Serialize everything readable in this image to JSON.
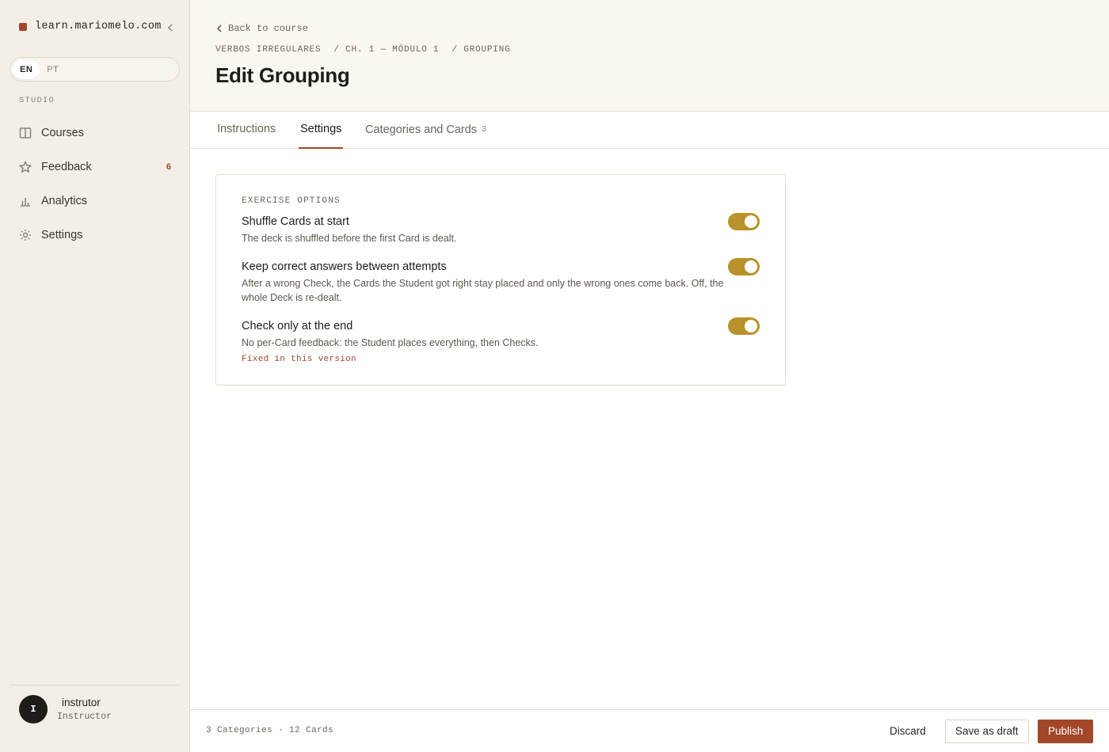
{
  "sidebar": {
    "brand": "learn.mariomelo.com",
    "lang": [
      "EN",
      "PT"
    ],
    "section_label": "STUDIO",
    "items": [
      {
        "label": "Courses",
        "icon": "book-icon"
      },
      {
        "label": "Feedback",
        "icon": "star-icon",
        "badge": "6"
      },
      {
        "label": "Analytics",
        "icon": "bar-chart-icon"
      },
      {
        "label": "Settings",
        "icon": "gear-icon"
      }
    ],
    "user": {
      "initial": "I",
      "name": "instrutor",
      "role": "Instructor"
    }
  },
  "header": {
    "back": "Back to course",
    "breadcrumb": [
      "VERBOS IRREGULARES",
      "/ CH. 1 — MÓDULO 1",
      "/ GROUPING"
    ],
    "title": "Edit Grouping"
  },
  "tabs": [
    {
      "label": "Instructions"
    },
    {
      "label": "Settings",
      "active": true
    },
    {
      "label": "Categories and Cards",
      "count": "3"
    }
  ],
  "options": {
    "label": "EXERCISE OPTIONS",
    "items": [
      {
        "title": "Shuffle Cards at start",
        "desc": "The deck is shuffled before the first Card is dealt.",
        "on": true
      },
      {
        "title": "Keep correct answers between attempts",
        "desc": "After a wrong Check, the Cards the Student got right stay placed and only the wrong ones come back. Off, the whole Deck is re-dealt.",
        "on": true
      },
      {
        "title": "Check only at the end",
        "desc": "No per-Card feedback: the Student places everything, then Checks.",
        "on": true
      }
    ],
    "fixed_note": "Fixed in this version"
  },
  "footer": {
    "status": "3 Categories · 12 Cards",
    "discard": "Discard",
    "draft": "Save as draft",
    "publish": "Publish"
  },
  "colors": {
    "accent": "#a3472a",
    "toggle_on": "#b8922a",
    "sidebar_bg": "#f3efe6"
  }
}
